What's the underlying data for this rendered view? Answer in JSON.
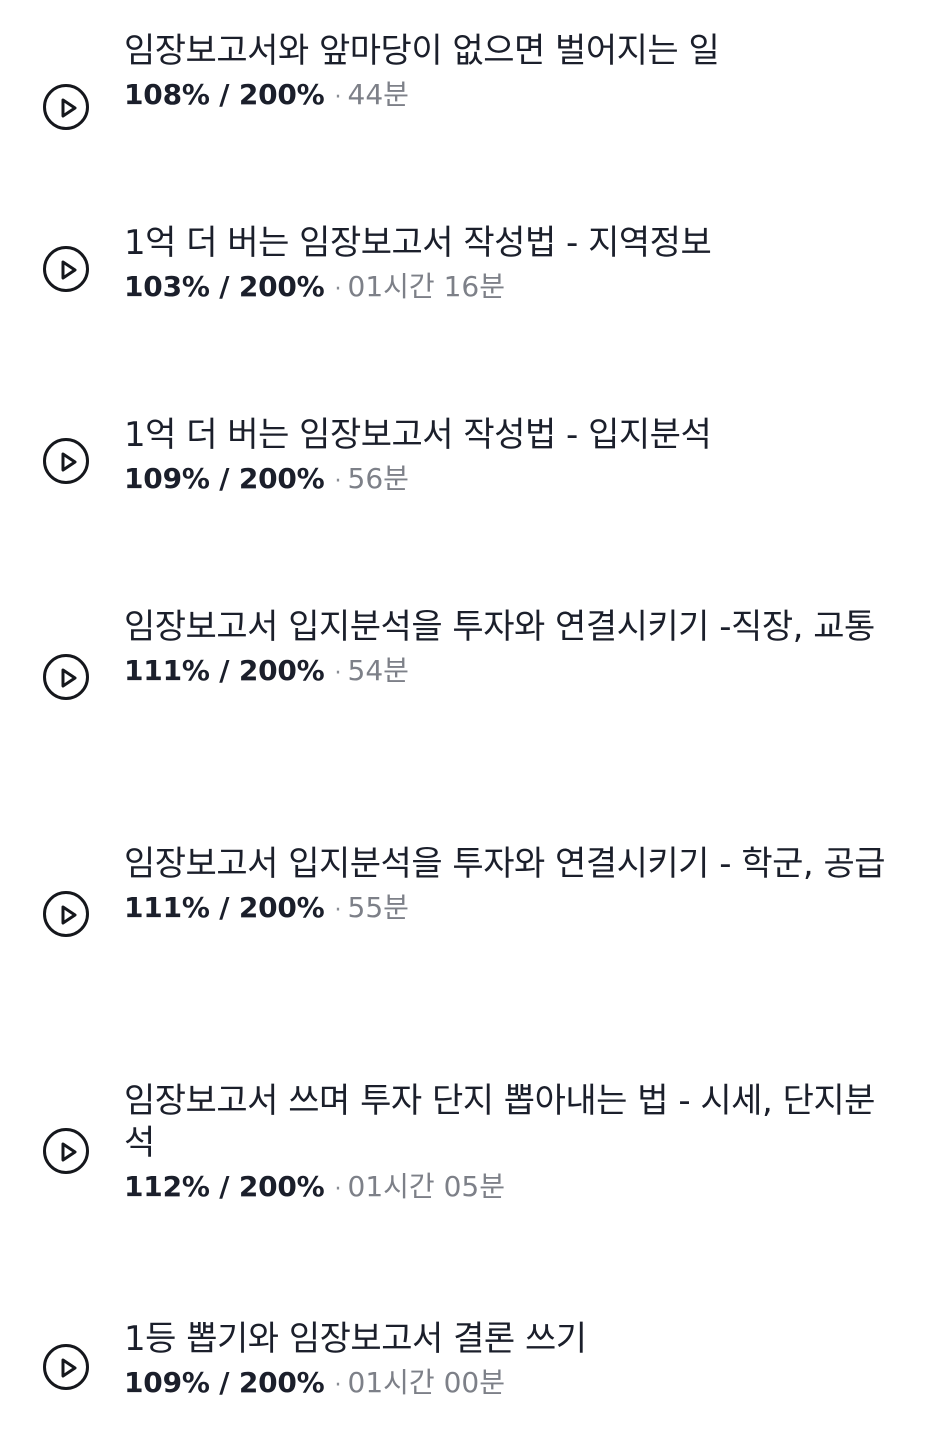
{
  "lectures": [
    {
      "title": "임장보고서와 앞마당이 없으면 벌어지는 일",
      "progress": "108% / 200%",
      "separator": "·",
      "duration": "44분"
    },
    {
      "title": "1억 더 버는 임장보고서 작성법 - 지역정보",
      "progress": "103% / 200%",
      "separator": "·",
      "duration": "01시간 16분"
    },
    {
      "title": "1억 더 버는 임장보고서 작성법 - 입지분석",
      "progress": "109% / 200%",
      "separator": "·",
      "duration": "56분"
    },
    {
      "title": "임장보고서 입지분석을 투자와 연결시키기 -직장, 교통",
      "progress": "111% / 200%",
      "separator": "·",
      "duration": "54분"
    },
    {
      "title": "임장보고서 입지분석을 투자와 연결시키기 - 학군, 공급",
      "progress": "111% / 200%",
      "separator": "·",
      "duration": "55분"
    },
    {
      "title": "임장보고서 쓰며 투자 단지 뽑아내는 법 - 시세, 단지분석",
      "progress": "112% / 200%",
      "separator": "·",
      "duration": "01시간 05분"
    },
    {
      "title": "1등 뽑기와 임장보고서 결론 쓰기",
      "progress": "109% / 200%",
      "separator": "·",
      "duration": "01시간 00분"
    }
  ],
  "icons": {
    "play": "play-circle-icon"
  },
  "colors": {
    "title": "#1b1f2b",
    "progress": "#1b1f2b",
    "duration": "#7d8088",
    "icon": "#15171c"
  }
}
